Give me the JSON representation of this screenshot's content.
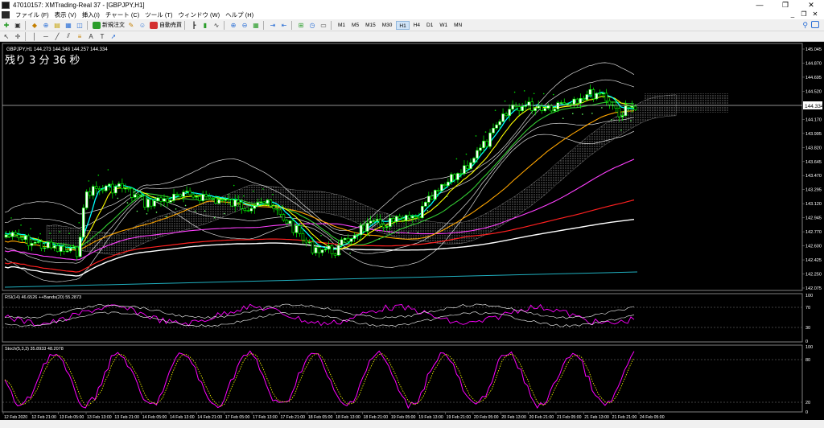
{
  "window": {
    "title": "47010157: XMTrading-Real 37 - [GBPJPY,H1]",
    "buttons": [
      "—",
      "❐",
      "✕"
    ]
  },
  "menu": {
    "items": [
      "ファイル (F)",
      "表示 (V)",
      "挿入(I)",
      "チャート (C)",
      "ツール (T)",
      "ウィンドウ (W)",
      "ヘルプ (H)"
    ],
    "mdi_buttons": [
      "_",
      "❐",
      "✕"
    ]
  },
  "toolbar": {
    "new_order_label": "新規注文",
    "auto_trade_label": "自動売買",
    "timeframes": [
      "M1",
      "M5",
      "M15",
      "M30",
      "H1",
      "H4",
      "D1",
      "W1",
      "MN"
    ],
    "active_timeframe": "H1"
  },
  "chart": {
    "symbol_info": "GBPJPY,H1  144.273 144.348 144.257 144.334",
    "countdown": "残り 3 分 36 秒",
    "current_price_label": "144.334",
    "price_axis": [
      "145.045",
      "144.870",
      "144.695",
      "144.520",
      "144.334",
      "144.170",
      "143.995",
      "143.820",
      "143.645",
      "143.470",
      "143.295",
      "143.120",
      "142.945",
      "142.770",
      "142.600",
      "142.425",
      "142.250",
      "142.075"
    ],
    "rsi_label": "RSI(14) 46.6526  ++Bands(20) 55.2873",
    "rsi_axis": [
      "100",
      "70",
      "30",
      "0"
    ],
    "stoch_label": "Stoch(5,3,3) 35.8933 48.2078",
    "stoch_axis": [
      "100",
      "80",
      "20",
      "0"
    ],
    "time_axis": [
      "12 Feb 2020",
      "12 Feb 21:00",
      "13 Feb 05:00",
      "13 Feb 13:00",
      "13 Feb 21:00",
      "14 Feb 05:00",
      "14 Feb 13:00",
      "14 Feb 21:00",
      "17 Feb 05:00",
      "17 Feb 13:00",
      "17 Feb 21:00",
      "18 Feb 05:00",
      "18 Feb 13:00",
      "18 Feb 21:00",
      "19 Feb 05:00",
      "19 Feb 13:00",
      "19 Feb 21:00",
      "20 Feb 05:00",
      "20 Feb 13:00",
      "20 Feb 21:00",
      "21 Feb 05:00",
      "21 Feb 13:00",
      "21 Feb 21:00",
      "24 Feb 05:00"
    ],
    "colors": {
      "background": "#000000",
      "candle": "#00ff00",
      "price_line": "#c0c0c0",
      "ma_white": "#ffffff",
      "ma_red": "#ff2020",
      "ma_magenta": "#ff40ff",
      "ma_orange": "#ffa500",
      "ma_yellow": "#ffff00",
      "ma_green": "#33cc33",
      "ma_cyan": "#00ffff",
      "rsi": "#ff00ff",
      "stoch_main": "#ff00ff",
      "stoch_signal": "#ffff00"
    }
  }
}
